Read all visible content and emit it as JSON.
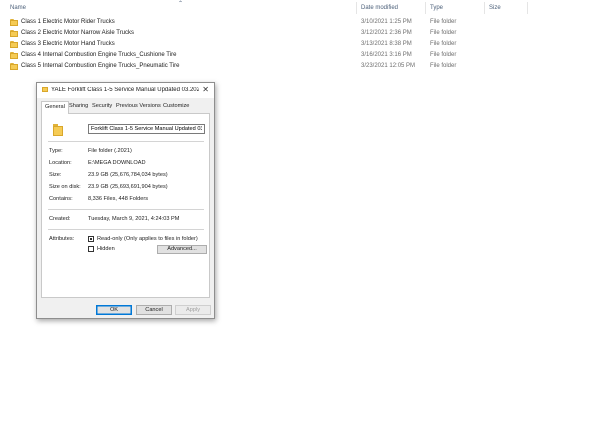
{
  "explorer": {
    "columns": {
      "name": "Name",
      "date_modified": "Date modified",
      "type": "Type",
      "size": "Size"
    },
    "files": [
      {
        "name": "Class 1 Electric Motor Rider Trucks",
        "date": "3/10/2021 1:25 PM",
        "type": "File folder"
      },
      {
        "name": "Class 2 Electric Motor Narrow Aisle Trucks",
        "date": "3/12/2021 2:36 PM",
        "type": "File folder"
      },
      {
        "name": "Class 3 Electric Motor Hand Trucks",
        "date": "3/13/2021 8:38 PM",
        "type": "File folder"
      },
      {
        "name": "Class 4 Internal Combustion Engine Trucks_Cushione Tire",
        "date": "3/16/2021 3:16 PM",
        "type": "File folder"
      },
      {
        "name": "Class 5 Internal Combustion Engine Trucks_Pneumatic Tire",
        "date": "3/23/2021 12:05 PM",
        "type": "File folder"
      }
    ]
  },
  "dialog": {
    "title": "YALE Forklift Class 1-5 Service Manual Updated 03.2021...",
    "tabs": [
      "General",
      "Sharing",
      "Security",
      "Previous Versions",
      "Customize"
    ],
    "folder_name": "Forklift Class 1-5 Service Manual Updated 03.2021",
    "props": {
      "type_label": "Type:",
      "type_value": "File folder (.2021)",
      "location_label": "Location:",
      "location_value": "E:\\MEGA DOWNLOAD",
      "size_label": "Size:",
      "size_value": "23.9 GB (25,676,784,034 bytes)",
      "size_on_disk_label": "Size on disk:",
      "size_on_disk_value": "23.9 GB (25,693,691,904 bytes)",
      "contains_label": "Contains:",
      "contains_value": "8,336 Files, 448 Folders",
      "created_label": "Created:",
      "created_value": "Tuesday, March 9, 2021, 4:24:03 PM",
      "attributes_label": "Attributes:",
      "readonly_label": "Read-only (Only applies to files in folder)",
      "hidden_label": "Hidden",
      "advanced_label": "Advanced..."
    },
    "buttons": {
      "ok": "OK",
      "cancel": "Cancel",
      "apply": "Apply"
    }
  },
  "colors": {
    "folder": "#f5cb55",
    "accent": "#0078d7",
    "dialog_bg": "#f0f0f0"
  },
  "icons": {
    "folder": "folder-icon",
    "close": "close-icon",
    "sort": "chevron-up-icon"
  }
}
